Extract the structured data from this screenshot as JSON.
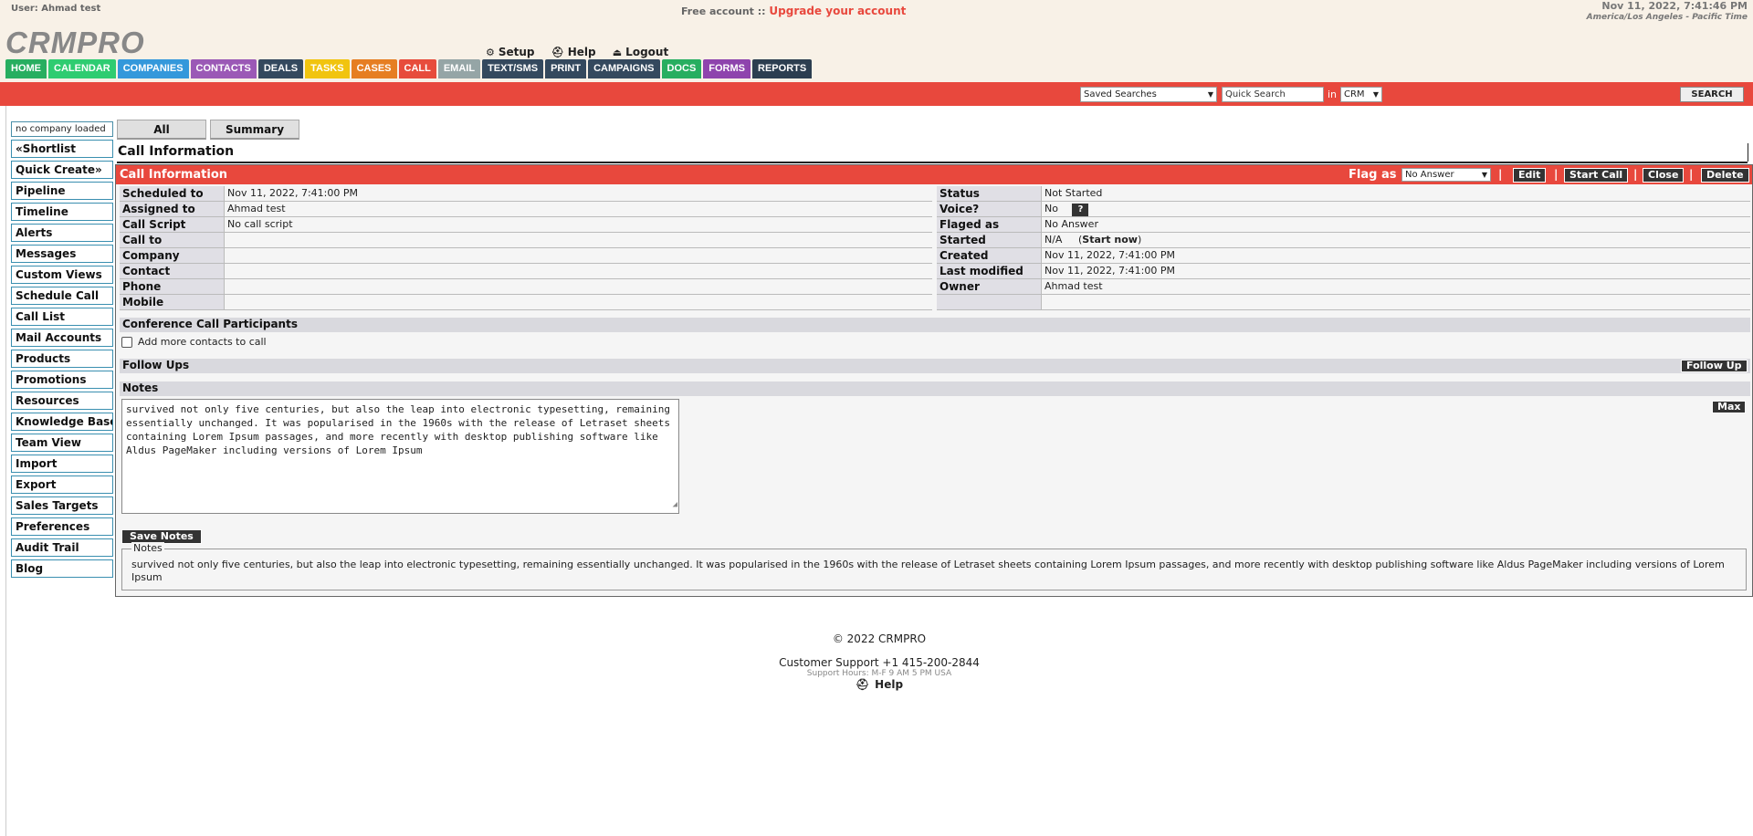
{
  "header": {
    "user_label": "User: Ahmad test",
    "free_account": "Free account ::",
    "upgrade_link": "Upgrade your account",
    "datetime": "Nov 11, 2022, 7:41:46 PM",
    "timezone": "America/Los Angeles - Pacific Time",
    "logo": "CRMPRO",
    "links": {
      "setup": "Setup",
      "help": "Help",
      "logout": "Logout"
    }
  },
  "nav": [
    {
      "label": "HOME",
      "color": "#27ae60"
    },
    {
      "label": "CALENDAR",
      "color": "#2ecc71"
    },
    {
      "label": "COMPANIES",
      "color": "#3498db"
    },
    {
      "label": "CONTACTS",
      "color": "#9b59b6"
    },
    {
      "label": "DEALS",
      "color": "#34495e"
    },
    {
      "label": "TASKS",
      "color": "#f1c40f"
    },
    {
      "label": "CASES",
      "color": "#e67e22"
    },
    {
      "label": "CALL",
      "color": "#e74c3c"
    },
    {
      "label": "EMAIL",
      "color": "#95a5a6"
    },
    {
      "label": "TEXT/SMS",
      "color": "#34495e"
    },
    {
      "label": "PRINT",
      "color": "#34495e"
    },
    {
      "label": "CAMPAIGNS",
      "color": "#34495e"
    },
    {
      "label": "DOCS",
      "color": "#27ae60"
    },
    {
      "label": "FORMS",
      "color": "#8e44ad"
    },
    {
      "label": "REPORTS",
      "color": "#2c3e50"
    }
  ],
  "search": {
    "saved_searches": "Saved Searches",
    "quick_search": "Quick Search",
    "in_label": "in",
    "scope": "CRM",
    "button": "SEARCH"
  },
  "sidebar": {
    "company_box": "no company loaded",
    "items": [
      "«Shortlist",
      "Quick Create»",
      "Pipeline",
      "Timeline",
      "Alerts",
      "Messages",
      "Custom Views",
      "Schedule Call",
      "Call List",
      "Mail Accounts",
      "Products",
      "Promotions",
      "Resources",
      "Knowledge Base",
      "Team View",
      "Import",
      "Export",
      "Sales Targets",
      "Preferences",
      "Audit Trail",
      "Blog"
    ]
  },
  "tabs": {
    "all": "All",
    "summary": "Summary"
  },
  "section_title": "Call Information",
  "panel": {
    "title": "Call Information",
    "flag_label": "Flag as",
    "flag_value": "No Answer",
    "buttons": {
      "edit": "Edit",
      "start_call": "Start Call",
      "close": "Close",
      "delete": "Delete"
    },
    "sep": "|",
    "left_fields": [
      {
        "label": "Scheduled to",
        "value": "Nov 11, 2022, 7:41:00 PM"
      },
      {
        "label": "Assigned to",
        "value": "Ahmad test"
      },
      {
        "label": "Call Script",
        "value": "No call script"
      },
      {
        "label": "Call to",
        "value": ""
      },
      {
        "label": "Company",
        "value": ""
      },
      {
        "label": "Contact",
        "value": ""
      },
      {
        "label": "Phone",
        "value": ""
      },
      {
        "label": "Mobile",
        "value": ""
      }
    ],
    "right_fields": {
      "status": {
        "label": "Status",
        "value": "Not Started"
      },
      "voice": {
        "label": "Voice?",
        "value": "No",
        "help": "?"
      },
      "flagged": {
        "label": "Flaged as",
        "value": "No Answer"
      },
      "started": {
        "label": "Started",
        "value": "N/A",
        "action": "Start now"
      },
      "created": {
        "label": "Created",
        "value": "Nov 11, 2022, 7:41:00 PM"
      },
      "modified": {
        "label": "Last modified",
        "value": "Nov 11, 2022, 7:41:00 PM"
      },
      "owner": {
        "label": "Owner",
        "value": "Ahmad test"
      }
    },
    "conference_title": "Conference Call Participants",
    "add_contacts": "Add more contacts to call",
    "follow_ups_title": "Follow Ups",
    "follow_up_button": "Follow Up",
    "notes_title": "Notes",
    "max_button": "Max",
    "notes_text": "survived not only five centuries, but also the leap into electronic typesetting, remaining essentially unchanged. It was popularised in the 1960s with the release of Letraset sheets containing Lorem Ipsum passages, and more recently with desktop publishing software like Aldus PageMaker including versions of Lorem Ipsum",
    "save_notes": "Save Notes",
    "fieldset_legend": "Notes",
    "fieldset_text": "survived not only five centuries, but also the leap into electronic typesetting, remaining essentially unchanged. It was popularised in the 1960s with the release of Letraset sheets containing Lorem Ipsum passages, and more recently with desktop publishing software like Aldus PageMaker including versions of Lorem Ipsum"
  },
  "footer": {
    "copyright": "© 2022 CRMPRO",
    "support": "Customer Support +1 415-200-2844",
    "hours": "Support Hours: M-F 9 AM 5 PM USA",
    "help": "Help"
  }
}
